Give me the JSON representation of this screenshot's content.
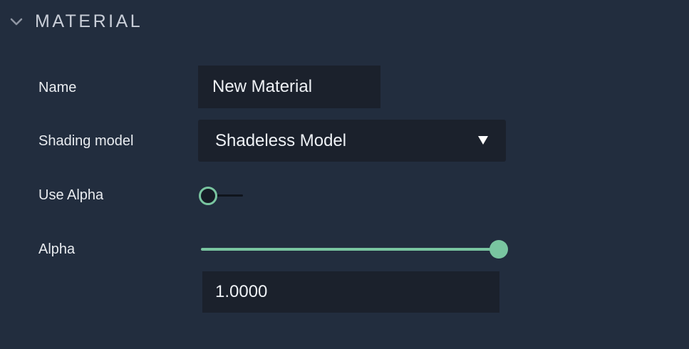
{
  "section": {
    "title": "MATERIAL",
    "chevron_icon": "chevron-down-icon"
  },
  "fields": {
    "name": {
      "label": "Name",
      "value": "New Material"
    },
    "shading_model": {
      "label": "Shading model",
      "value": "Shadeless Model",
      "arrow_icon": "caret-down-icon"
    },
    "use_alpha": {
      "label": "Use Alpha",
      "checked": false
    },
    "alpha": {
      "label": "Alpha",
      "slider_value": 1.0,
      "slider_min": 0.0,
      "slider_max": 1.0,
      "value_text": "1.0000"
    }
  },
  "colors": {
    "background": "#222d3e",
    "field_background": "#1b212c",
    "accent": "#79c5a0"
  }
}
